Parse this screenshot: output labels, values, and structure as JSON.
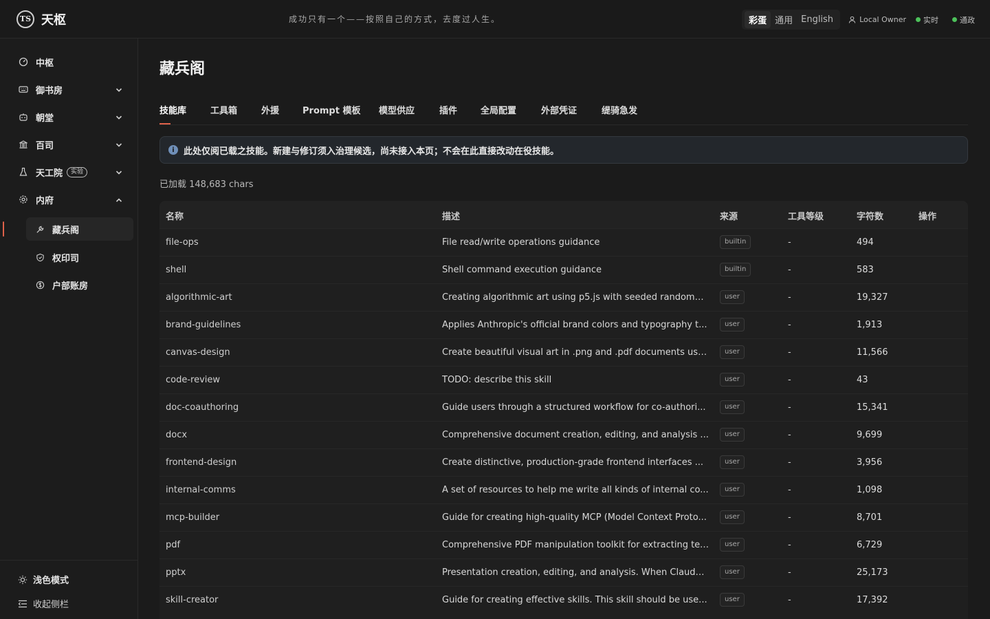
{
  "app": {
    "logo_text": "天枢",
    "logo_mark": "TS"
  },
  "header": {
    "motto": "成功只有一个——按照自己的方式，去度过人生。",
    "theme_options": [
      "彩蛋",
      "通用",
      "English"
    ],
    "owner": "Local Owner",
    "status_realtime": "实时",
    "status_connected": "通政"
  },
  "sidebar": {
    "items": [
      {
        "label": "中枢",
        "icon": "dashboard-icon"
      },
      {
        "label": "御书房",
        "icon": "keyboard-icon"
      },
      {
        "label": "朝堂",
        "icon": "robot-icon"
      },
      {
        "label": "百司",
        "icon": "building-icon"
      },
      {
        "label": "天工院",
        "icon": "flask-icon",
        "badge": "实验"
      },
      {
        "label": "内府",
        "icon": "gear-icon"
      }
    ],
    "sub_items": [
      {
        "label": "藏兵阁",
        "icon": "wrench-icon"
      },
      {
        "label": "权印司",
        "icon": "shield-icon"
      },
      {
        "label": "户部账房",
        "icon": "coin-icon"
      }
    ],
    "bottom": {
      "light_mode": "浅色模式",
      "collapse": "收起侧栏"
    }
  },
  "main": {
    "title": "藏兵阁",
    "tabs": [
      "技能库",
      "工具箱",
      "外援",
      "Prompt 模板",
      "模型供应",
      "插件",
      "全局配置",
      "外部凭证",
      "缇骑急发"
    ],
    "notice": "此处仅阅已载之技能。新建与修订须入治理候选，尚未接入本页；不会在此直接改动在役技能。",
    "loaded": "已加载 148,683 chars"
  },
  "table": {
    "headers": [
      "名称",
      "描述",
      "来源",
      "工具等级",
      "字符数",
      "操作"
    ],
    "rows": [
      {
        "name": "file-ops",
        "desc": "File read/write operations guidance",
        "source": "builtin",
        "level": "-",
        "chars": "494"
      },
      {
        "name": "shell",
        "desc": "Shell command execution guidance",
        "source": "builtin",
        "level": "-",
        "chars": "583"
      },
      {
        "name": "algorithmic-art",
        "desc": "Creating algorithmic art using p5.js with seeded randomn...",
        "source": "user",
        "level": "-",
        "chars": "19,327"
      },
      {
        "name": "brand-guidelines",
        "desc": "Applies Anthropic's official brand colors and typography t...",
        "source": "user",
        "level": "-",
        "chars": "1,913"
      },
      {
        "name": "canvas-design",
        "desc": "Create beautiful visual art in .png and .pdf documents usi...",
        "source": "user",
        "level": "-",
        "chars": "11,566"
      },
      {
        "name": "code-review",
        "desc": "TODO: describe this skill",
        "source": "user",
        "level": "-",
        "chars": "43"
      },
      {
        "name": "doc-coauthoring",
        "desc": "Guide users through a structured workflow for co-authori...",
        "source": "user",
        "level": "-",
        "chars": "15,341"
      },
      {
        "name": "docx",
        "desc": "Comprehensive document creation, editing, and analysis ...",
        "source": "user",
        "level": "-",
        "chars": "9,699"
      },
      {
        "name": "frontend-design",
        "desc": "Create distinctive, production-grade frontend interfaces ...",
        "source": "user",
        "level": "-",
        "chars": "3,956"
      },
      {
        "name": "internal-comms",
        "desc": "A set of resources to help me write all kinds of internal co...",
        "source": "user",
        "level": "-",
        "chars": "1,098"
      },
      {
        "name": "mcp-builder",
        "desc": "Guide for creating high-quality MCP (Model Context Proto...",
        "source": "user",
        "level": "-",
        "chars": "8,701"
      },
      {
        "name": "pdf",
        "desc": "Comprehensive PDF manipulation toolkit for extracting tex...",
        "source": "user",
        "level": "-",
        "chars": "6,729"
      },
      {
        "name": "pptx",
        "desc": "Presentation creation, editing, and analysis. When Claude ...",
        "source": "user",
        "level": "-",
        "chars": "25,173"
      },
      {
        "name": "skill-creator",
        "desc": "Guide for creating effective skills. This skill should be use...",
        "source": "user",
        "level": "-",
        "chars": "17,392"
      }
    ]
  },
  "colors": {
    "accent": "#e0614a",
    "status_green": "#4cc15a",
    "notice_bg": "#23272c"
  }
}
